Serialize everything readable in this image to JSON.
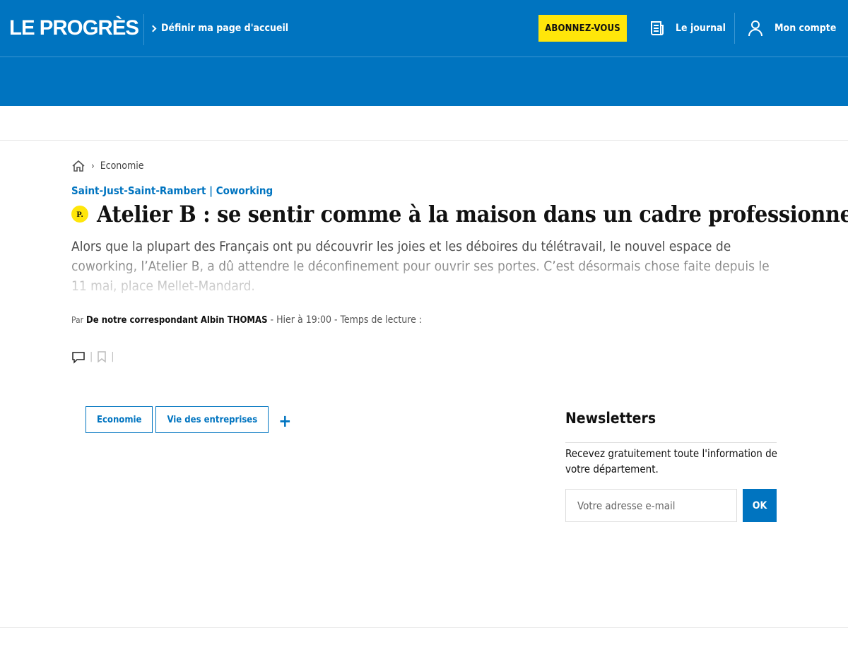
{
  "header": {
    "logo": "LE PROGRÈS",
    "homepage_link": "Définir ma page d'accueil",
    "subscribe_button": "ABONNEZ-VOUS",
    "journal_link": "Le journal",
    "account_link": "Mon compte",
    "brand_color": "#0074c0",
    "subscribe_color": "#ffe60a"
  },
  "breadcrumb": {
    "home_icon": "home-icon",
    "separator": "›",
    "section": "Economie"
  },
  "article": {
    "kicker": "Saint-Just-Saint-Rambert | Coworking",
    "premium_badge": "P.",
    "title": "Atelier B : se sentir comme à la maison dans un cadre professionnel",
    "chapo": "Alors que la plupart des Français ont pu découvrir les joies et les déboires du télétravail, le nouvel espace de coworking, l’Atelier B, a dû attendre le déconfinement pour ouvrir ses portes. C’est désormais chose faite depuis le 11 mai, place Mellet-Mandard.",
    "byline_prefix": "Par",
    "author": "De notre correspondant Albin THOMAS",
    "meta": "- Hier à 19:00 - Temps de lecture :",
    "actions": {
      "comment_icon": "comment-icon",
      "bookmark_icon": "bookmark-icon",
      "separator": "|"
    }
  },
  "tags": {
    "items": [
      "Economie",
      "Vie des entreprises"
    ],
    "more": "+"
  },
  "newsletter": {
    "title": "Newsletters",
    "description": "Recevez gratuitement toute l'information de votre département.",
    "email_placeholder": "Votre adresse e-mail",
    "submit": "OK"
  }
}
